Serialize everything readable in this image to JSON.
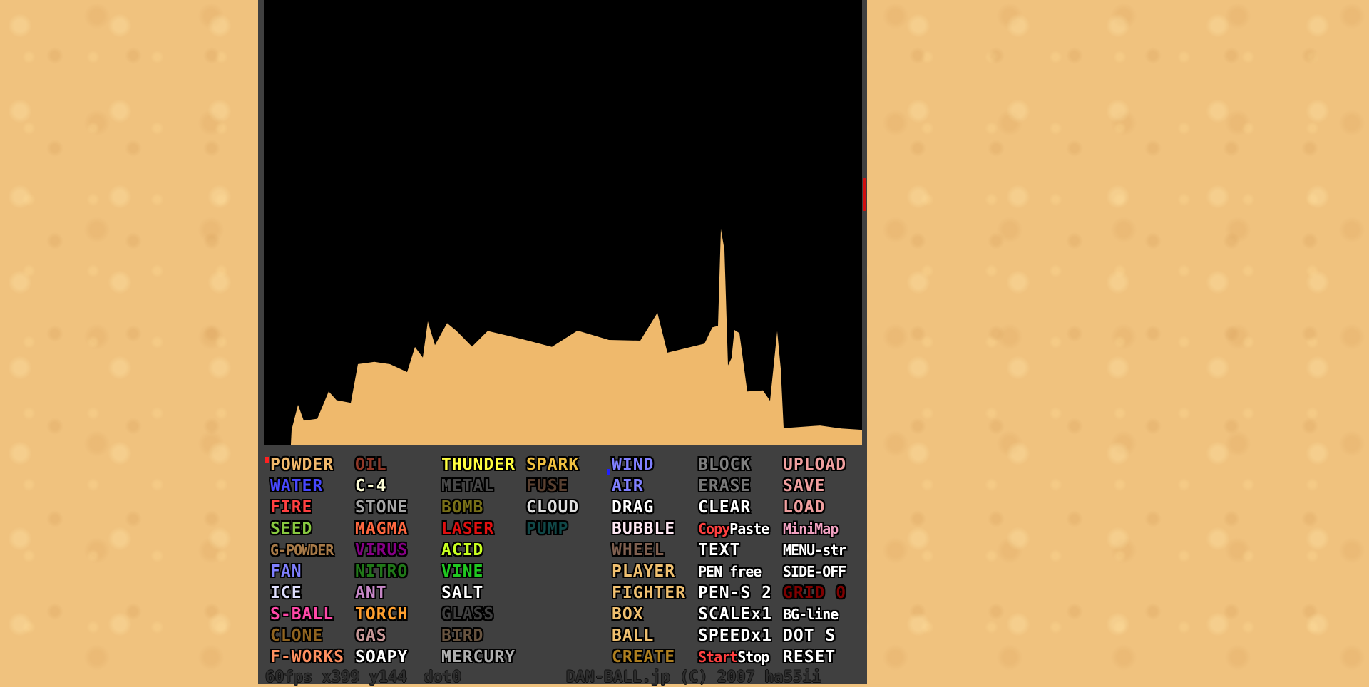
{
  "colors": {
    "sand": "#efb96c",
    "menu_bg": "#404040",
    "canvas_bg": "#000000",
    "page_bg": "#f0c27e"
  },
  "selection": {
    "left_tool": "POWDER",
    "right_tool": "WIND",
    "left_marker_color": "#ff2020",
    "right_marker_color": "#2020ff"
  },
  "menu": {
    "columns": [
      [
        {
          "label": "POWDER",
          "color": "#f2b96c"
        },
        {
          "label": "WATER",
          "color": "#4848ff"
        },
        {
          "label": "FIRE",
          "color": "#ff4040"
        },
        {
          "label": "SEED",
          "color": "#88c840"
        },
        {
          "label": "G-POWDER",
          "color": "#a87a48",
          "small": true
        },
        {
          "label": "FAN",
          "color": "#8080ff"
        },
        {
          "label": "ICE",
          "color": "#e0e0ff"
        },
        {
          "label": "S-BALL",
          "color": "#ff48a8"
        },
        {
          "label": "CLONE",
          "color": "#906420"
        },
        {
          "label": "F-WORKS",
          "color": "#ff9060"
        }
      ],
      [
        {
          "label": "OIL",
          "color": "#903828"
        },
        {
          "label": "C-4",
          "color": "#ffffd8"
        },
        {
          "label": "STONE",
          "color": "#a8a8a8"
        },
        {
          "label": "MAGMA",
          "color": "#ff6840"
        },
        {
          "label": "VIRUS",
          "color": "#880088"
        },
        {
          "label": "NITRO",
          "color": "#207818"
        },
        {
          "label": "ANT",
          "color": "#c888c8"
        },
        {
          "label": "TORCH",
          "color": "#ffa030"
        },
        {
          "label": "GAS",
          "color": "#c89898"
        },
        {
          "label": "SOAPY",
          "color": "#ffffff"
        }
      ],
      [
        {
          "label": "THUNDER",
          "color": "#ffff40"
        },
        {
          "label": "METAL",
          "color": "#484848"
        },
        {
          "label": "BOMB",
          "color": "#787018"
        },
        {
          "label": "LASER",
          "color": "#e01010"
        },
        {
          "label": "ACID",
          "color": "#c8ff20"
        },
        {
          "label": "VINE",
          "color": "#20c820"
        },
        {
          "label": "SALT",
          "color": "#ffffff"
        },
        {
          "label": "GLASS",
          "color": "#404040"
        },
        {
          "label": "BIRD",
          "color": "#685440"
        },
        {
          "label": "MERCURY",
          "color": "#b0b0b0"
        }
      ],
      [
        {
          "label": "SPARK",
          "color": "#f0c040"
        },
        {
          "label": "FUSE",
          "color": "#5a4030"
        },
        {
          "label": "CLOUD",
          "color": "#e0e0e0"
        },
        {
          "label": "PUMP",
          "color": "#104848"
        }
      ],
      [
        {
          "label": "WIND",
          "color": "#8080ff"
        },
        {
          "label": "AIR",
          "color": "#8080ff"
        },
        {
          "label": "DRAG",
          "color": "#ffffff"
        },
        {
          "label": "BUBBLE",
          "color": "#ffe8f4"
        },
        {
          "label": "WHEEL",
          "color": "#806050"
        },
        {
          "label": "PLAYER",
          "color": "#f0c070"
        },
        {
          "label": "FIGHTER",
          "color": "#f0c070"
        },
        {
          "label": "BOX",
          "color": "#f0c070"
        },
        {
          "label": "BALL",
          "color": "#f0c070"
        },
        {
          "label": "CREATE",
          "color": "#b08020"
        }
      ],
      [
        {
          "label": "BLOCK",
          "color": "#808080"
        },
        {
          "label": "ERASE",
          "color": "#787878"
        },
        {
          "label": "CLEAR",
          "color": "#ffffff"
        },
        {
          "label": "Copy",
          "label2": "Paste",
          "color": "#ff4040",
          "color2": "#ffffff",
          "small": true
        },
        {
          "label": "TEXT",
          "color": "#ffffff"
        },
        {
          "label": "PEN free",
          "color": "#ffffff",
          "small": true
        },
        {
          "label": "PEN-S 2",
          "color": "#ffffff"
        },
        {
          "label": "SCALEx1",
          "color": "#ffffff"
        },
        {
          "label": "SPEEDx1",
          "color": "#ffffff"
        },
        {
          "label": "Start",
          "label2": "Stop",
          "color": "#ff4040",
          "color2": "#ffffff",
          "small": true
        }
      ],
      [
        {
          "label": "UPLOAD",
          "color": "#f0a0a0"
        },
        {
          "label": "SAVE",
          "color": "#f0a0a0"
        },
        {
          "label": "LOAD",
          "color": "#f0a0a0"
        },
        {
          "label": "MiniMap",
          "color": "#f0a0c0",
          "small": true
        },
        {
          "label": "MENU-str",
          "color": "#ffffff",
          "small": true
        },
        {
          "label": "SIDE-OFF",
          "color": "#ffffff",
          "small": true
        },
        {
          "label": "GRID 0",
          "color": "#800000"
        },
        {
          "label": "BG-line",
          "color": "#ffffff",
          "small": true
        },
        {
          "label": "DOT S",
          "color": "#ffffff"
        },
        {
          "label": "RESET",
          "color": "#ffffff"
        }
      ]
    ]
  },
  "status": {
    "fps": "60fps",
    "x": "x399",
    "y": "y144",
    "dot": "dot0",
    "credit": "DAN-BALL.jp (C) 2007 ha55ii"
  }
}
